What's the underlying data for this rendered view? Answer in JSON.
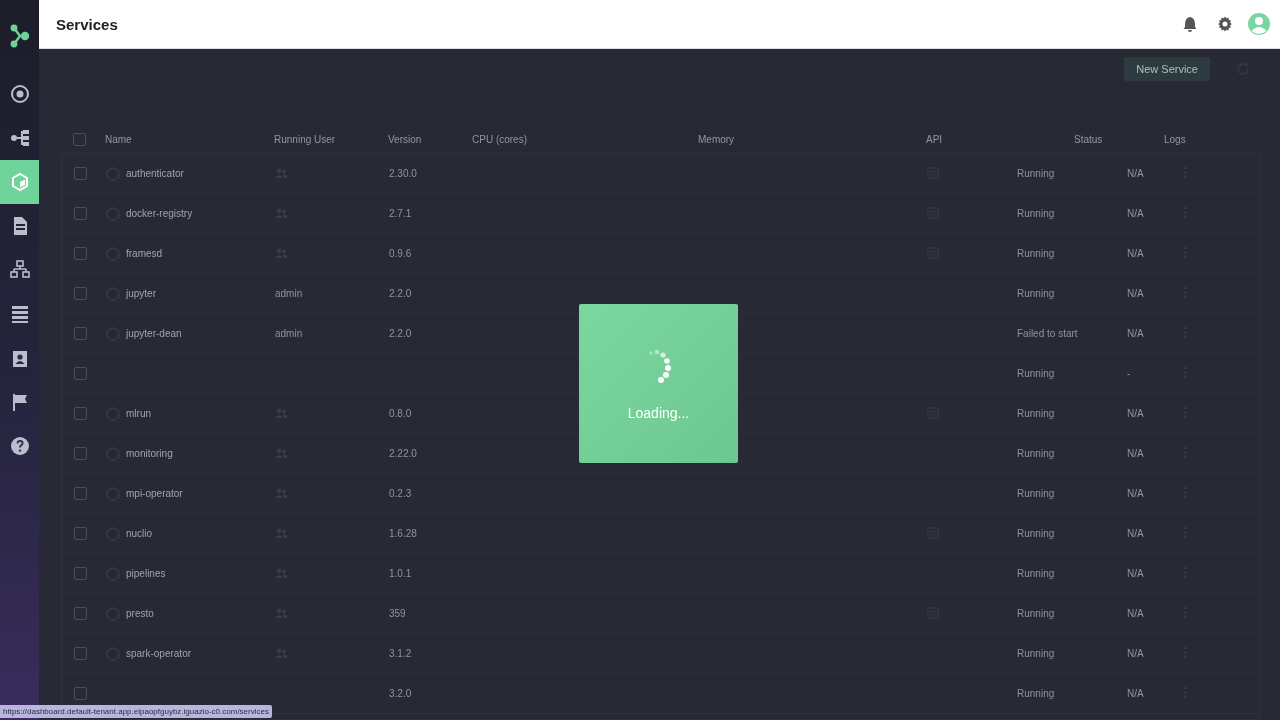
{
  "header": {
    "title": "Services"
  },
  "sidebar": {
    "items": [
      {
        "selected": false
      },
      {
        "selected": false
      },
      {
        "selected": true
      },
      {
        "selected": false
      },
      {
        "selected": false
      },
      {
        "selected": false
      },
      {
        "selected": false
      },
      {
        "selected": false
      },
      {
        "selected": false
      }
    ]
  },
  "toolbar": {
    "button": "New Service"
  },
  "table": {
    "all_checked": false,
    "columns": [
      "Name",
      "Running User",
      "Version",
      "CPU (cores)",
      "Memory",
      "API",
      "Status",
      "Logs"
    ],
    "rows": [
      {
        "checked": false,
        "name": "authenticator",
        "user": {
          "kind": "group"
        },
        "version": "2.30.0",
        "api": true,
        "status": "Running",
        "logs": "N/A"
      },
      {
        "checked": false,
        "name": "docker-registry",
        "user": {
          "kind": "group"
        },
        "version": "2.7.1",
        "api": true,
        "status": "Running",
        "logs": "N/A"
      },
      {
        "checked": false,
        "name": "framesd",
        "user": {
          "kind": "group"
        },
        "version": "0.9.6",
        "api": true,
        "status": "Running",
        "logs": "N/A"
      },
      {
        "checked": false,
        "name": "jupyter",
        "user": {
          "kind": "text",
          "text": "admin"
        },
        "version": "2.2.0",
        "api": false,
        "status": "Running",
        "logs": "N/A"
      },
      {
        "checked": false,
        "name": "jupyter-dean",
        "user": {
          "kind": "text",
          "text": "admin"
        },
        "version": "2.2.0",
        "api": false,
        "status": "Failed to start",
        "logs": "N/A"
      },
      {
        "checked": false,
        "user": {
          "kind": "none"
        },
        "api": false,
        "status": "Running",
        "logs": "-"
      },
      {
        "checked": false,
        "name": "mlrun",
        "user": {
          "kind": "group"
        },
        "version": "0.8.0",
        "api": true,
        "status": "Running",
        "logs": "N/A"
      },
      {
        "checked": false,
        "name": "monitoring",
        "user": {
          "kind": "group"
        },
        "version": "2.22.0",
        "api": false,
        "status": "Running",
        "logs": "N/A"
      },
      {
        "checked": false,
        "name": "mpi-operator",
        "user": {
          "kind": "group"
        },
        "version": "0.2.3",
        "api": false,
        "status": "Running",
        "logs": "N/A"
      },
      {
        "checked": false,
        "name": "nuclio",
        "user": {
          "kind": "group"
        },
        "version": "1.6.28",
        "api": true,
        "status": "Running",
        "logs": "N/A"
      },
      {
        "checked": false,
        "name": "pipelines",
        "user": {
          "kind": "group"
        },
        "version": "1.0.1",
        "api": false,
        "status": "Running",
        "logs": "N/A"
      },
      {
        "checked": false,
        "name": "presto",
        "user": {
          "kind": "group"
        },
        "version": "359",
        "api": true,
        "status": "Running",
        "logs": "N/A"
      },
      {
        "checked": false,
        "name": "spark-operator",
        "user": {
          "kind": "group"
        },
        "version": "3.1.2",
        "api": false,
        "status": "Running",
        "logs": "N/A"
      },
      {
        "checked": false,
        "user": {
          "kind": "none"
        },
        "version": "3.2.0",
        "api": false,
        "status": "Running",
        "logs": "N/A"
      }
    ]
  },
  "loading": {
    "text": "Loading..."
  },
  "status_url": "https://dashboard.default-tenant.app.elpaopfguybz.iguazio-c0.com/services"
}
